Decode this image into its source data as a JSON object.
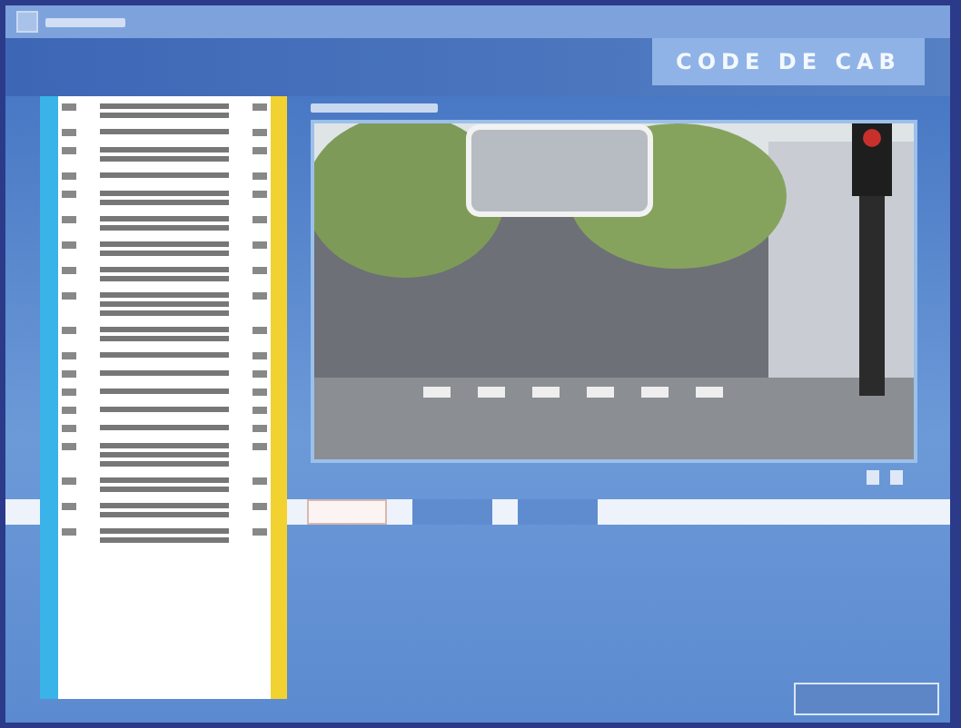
{
  "header": {
    "title": "CODE DE CAB"
  },
  "tabs": [
    {
      "selected": true
    },
    {
      "selected": false
    },
    {
      "selected": false
    }
  ]
}
